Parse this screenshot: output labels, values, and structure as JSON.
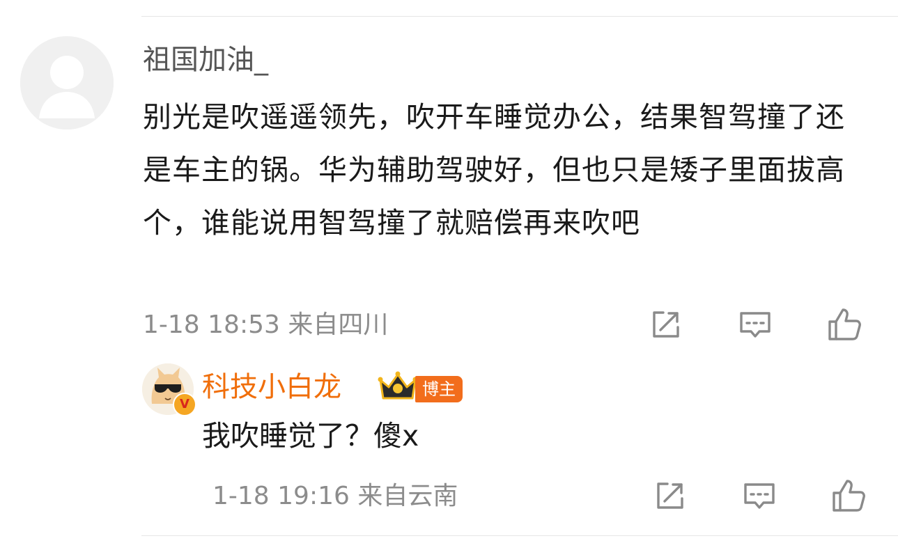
{
  "comment": {
    "username": "祖国加油_",
    "text": "别光是吹遥遥领先，吹开车睡觉办公，结果智驾撞了还是车主的锅。华为辅助驾驶好，但也只是矮子里面拔高个，谁能说用智驾撞了就赔偿再来吹吧",
    "time": "1-18 18:53",
    "location": "来自四川",
    "actions": {
      "share_icon": "share-icon",
      "comment_icon": "comment-icon",
      "like_icon": "thumbs-up-icon"
    }
  },
  "reply": {
    "username": "科技小白龙",
    "tag": "博主",
    "verified_badge": "V",
    "text": "我吹睡觉了？傻x",
    "time": "1-18 19:16",
    "location": "来自云南"
  },
  "colors": {
    "reply_name": "#f06e0a",
    "tag_background": "#f26d1c",
    "meta_text": "#8c8c8c"
  }
}
